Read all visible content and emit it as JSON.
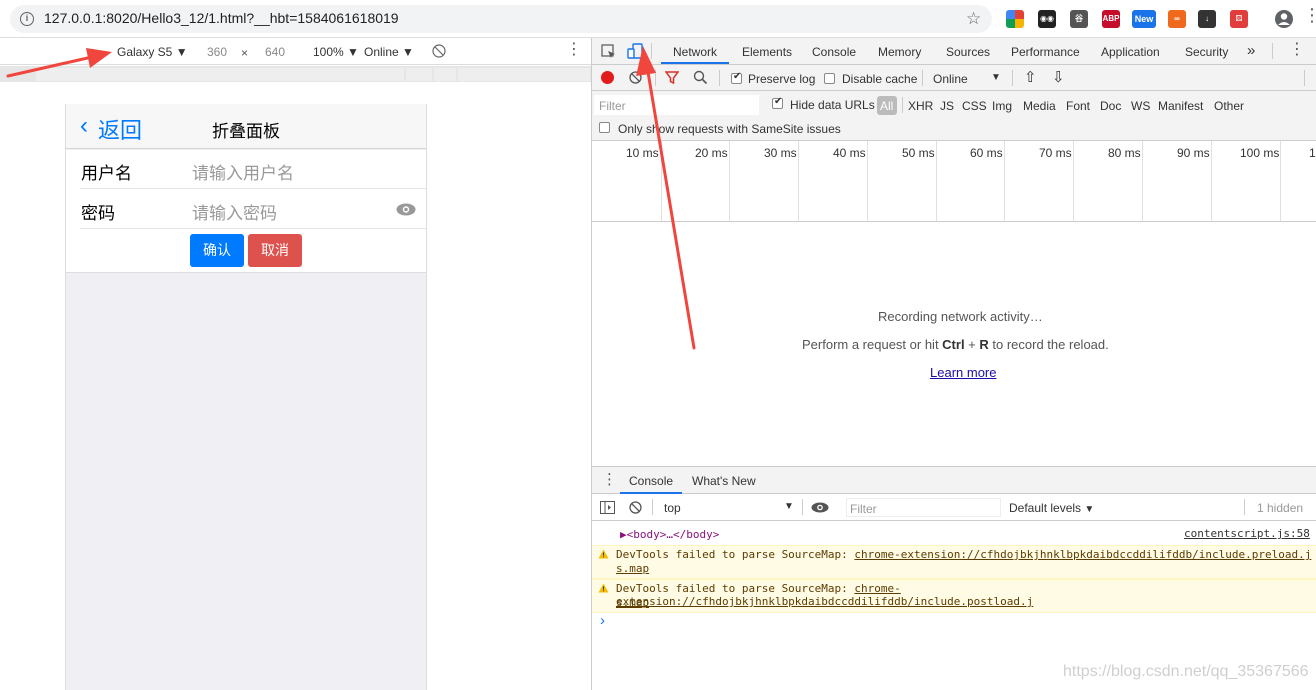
{
  "browser": {
    "url": "127.0.0.1:8020/Hello3_12/1.html?__hbt=1584061618019",
    "extensions": [
      {
        "name": "color-extension-icon",
        "color": "#e34133",
        "label": ""
      },
      {
        "name": "eyes-extension-icon",
        "color": "#222222",
        "label": "◉◉"
      },
      {
        "name": "cube-extension-icon",
        "color": "#555555",
        "label": "谷"
      },
      {
        "name": "abp-extension-icon",
        "color": "#c70d2c",
        "label": "ABP"
      },
      {
        "name": "new-extension-icon",
        "color": "#1a73e8",
        "label": "New"
      },
      {
        "name": "infinity-extension-icon",
        "color": "#f06a1d",
        "label": "∞"
      },
      {
        "name": "download-extension-icon",
        "color": "#333333",
        "label": "↓"
      },
      {
        "name": "dice-extension-icon",
        "color": "#e23d3d",
        "label": "⚄"
      }
    ]
  },
  "device_toolbar": {
    "device": "Galaxy S5",
    "width": "360",
    "times": "×",
    "height": "640",
    "zoom": "100%",
    "network": "Online"
  },
  "phone": {
    "back_chevron": "‹",
    "back_label": "返回",
    "title": "折叠面板",
    "username_label": "用户名",
    "username_placeholder": "请输入用户名",
    "password_label": "密码",
    "password_placeholder": "请输入密码",
    "confirm": "确认",
    "cancel": "取消",
    "confirm_color": "#007aff",
    "cancel_color": "#dd524d"
  },
  "devtools": {
    "tabs": [
      "Network",
      "Elements",
      "Console",
      "Memory",
      "Sources",
      "Performance",
      "Application",
      "Security"
    ],
    "active_tab": "Network",
    "more": "»",
    "net_toolbar": {
      "preserve_log": "Preserve log",
      "disable_cache": "Disable cache",
      "throttle": "Online"
    },
    "filter": {
      "placeholder": "Filter",
      "hide_data_urls": "Hide data URLs",
      "types": [
        "All",
        "XHR",
        "JS",
        "CSS",
        "Img",
        "Media",
        "Font",
        "Doc",
        "WS",
        "Manifest",
        "Other"
      ],
      "samesite": "Only show requests with SameSite issues"
    },
    "timeline_ticks": [
      "10 ms",
      "20 ms",
      "30 ms",
      "40 ms",
      "50 ms",
      "60 ms",
      "70 ms",
      "80 ms",
      "90 ms",
      "100 ms",
      "1"
    ],
    "recording": {
      "line1": "Recording network activity…",
      "line2_a": "Perform a request or hit ",
      "line2_b": "Ctrl",
      "line2_c": " + ",
      "line2_d": "R",
      "line2_e": " to record the reload.",
      "learn_more": "Learn more"
    },
    "drawer": {
      "tabs": [
        "Console",
        "What's New"
      ],
      "context": "top",
      "filter_placeholder": "Filter",
      "levels": "Default levels",
      "hidden": "1 hidden"
    },
    "console": {
      "body_line": "▶<body>…</body>",
      "body_source": "contentscript.js:58",
      "warn1_text": "DevTools failed to parse SourceMap: ",
      "warn1_link_a": "chrome-extension://cfhdojbkjhnklbpkdaibdccddilifddb/include.preload.j",
      "warn1_link_b": "s.map",
      "warn2_text": "DevTools failed to parse SourceMap: ",
      "warn2_link_a": "chrome-extension://cfhdojbkjhnklbpkdaibdccddilifddb/include.postload.j",
      "warn2_link_b": "s.map",
      "prompt": "›"
    }
  },
  "watermark": "https://blog.csdn.net/qq_35367566"
}
